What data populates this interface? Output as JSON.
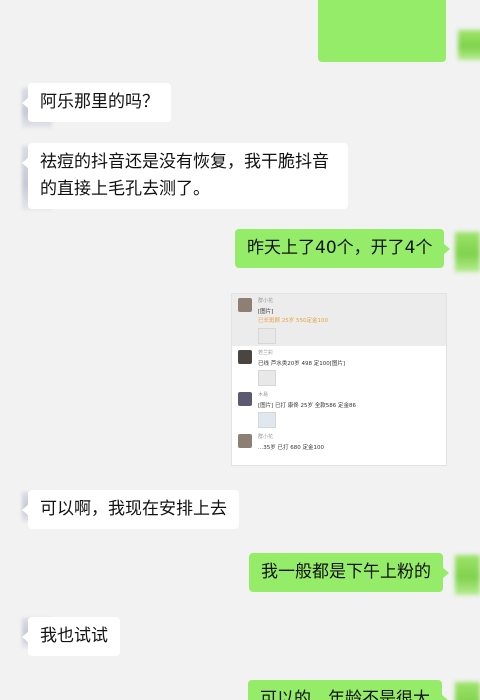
{
  "messages": [
    {
      "side": "in",
      "text": "阿乐那里的吗？"
    },
    {
      "side": "in",
      "text": "祛痘的抖音还是没有恢复，我干脆抖音的直接上毛孔去测了。"
    },
    {
      "side": "out",
      "text": "昨天上了40个，开了4个"
    },
    {
      "side": "in",
      "text": "可以啊，我现在安排上去"
    },
    {
      "side": "out",
      "text": "我一般都是下午上粉的"
    },
    {
      "side": "in",
      "text": "我也试试"
    },
    {
      "side": "out",
      "text": "可以的，年龄不是很大"
    }
  ],
  "image_message": {
    "items": [
      {
        "name": "群小花",
        "text": "[图片]",
        "text2": "已长斑顾 25岁 550定金100"
      },
      {
        "name": "若兰彩",
        "text": "已线 芦水类20岁 498 定100[图片]"
      },
      {
        "name": "木易",
        "text": "[图片] 已打 康佟 25岁 全款586 定金86"
      },
      {
        "name": "群小花",
        "text": "...35岁 已打 680 定金100"
      }
    ]
  },
  "colors": {
    "out_bubble": "#95ec69",
    "in_bubble": "#ffffff",
    "background": "#f2f2f2"
  }
}
